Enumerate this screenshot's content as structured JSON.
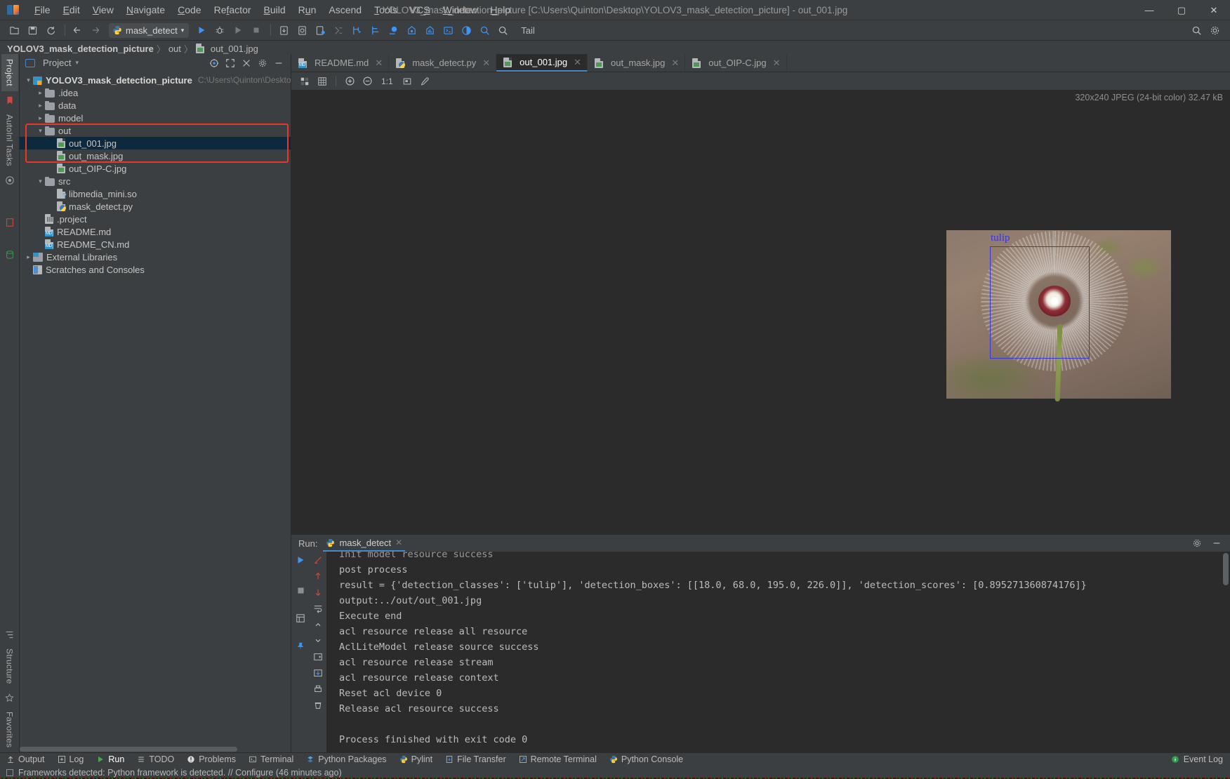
{
  "window": {
    "title": "YOLOV3_mask_detection_picture [C:\\Users\\Quinton\\Desktop\\YOLOV3_mask_detection_picture] - out_001.jpg",
    "minimize": "—",
    "maximize": "▢",
    "close": "✕"
  },
  "menu": [
    {
      "label": "File"
    },
    {
      "label": "Edit"
    },
    {
      "label": "View"
    },
    {
      "label": "Navigate"
    },
    {
      "label": "Code"
    },
    {
      "label": "Refactor"
    },
    {
      "label": "Build"
    },
    {
      "label": "Run"
    },
    {
      "label": "Ascend"
    },
    {
      "label": "Tools"
    },
    {
      "label": "VCS"
    },
    {
      "label": "Window"
    },
    {
      "label": "Help"
    }
  ],
  "toolbar": {
    "run_config": "mask_detect",
    "dropdown_arrow": "▾",
    "tail_label": "Tail"
  },
  "breadcrumb": {
    "project": "YOLOV3_mask_detection_picture",
    "folder": "out",
    "file": "out_001.jpg",
    "separator": "〉"
  },
  "left_stripe": {
    "project_tab": "Project",
    "ai_tab": "AutoInl Tasks",
    "structure_tab": "Structure",
    "favorites_tab": "Favorites"
  },
  "project_panel": {
    "title": "Project",
    "dropdown_arrow": "▾",
    "tree": [
      {
        "indent": 0,
        "arrow": "⌄",
        "icon": "module-icon",
        "label": "YOLOV3_mask_detection_picture",
        "bold": true,
        "path": "C:\\Users\\Quinton\\Desktop\\YOLO",
        "selected": false
      },
      {
        "indent": 1,
        "arrow": "›",
        "icon": "folder-icon",
        "label": ".idea",
        "bold": false,
        "path": "",
        "selected": false
      },
      {
        "indent": 1,
        "arrow": "›",
        "icon": "folder-icon",
        "label": "data",
        "bold": false,
        "path": "",
        "selected": false
      },
      {
        "indent": 1,
        "arrow": "›",
        "icon": "folder-icon",
        "label": "model",
        "bold": false,
        "path": "",
        "selected": false
      },
      {
        "indent": 1,
        "arrow": "⌄",
        "icon": "folder-icon",
        "label": "out",
        "bold": false,
        "path": "",
        "selected": false
      },
      {
        "indent": 2,
        "arrow": "",
        "icon": "image-file-icon",
        "label": "out_001.jpg",
        "bold": false,
        "path": "",
        "selected": true
      },
      {
        "indent": 2,
        "arrow": "",
        "icon": "image-file-icon",
        "label": "out_mask.jpg",
        "bold": false,
        "path": "",
        "selected": false
      },
      {
        "indent": 2,
        "arrow": "",
        "icon": "image-file-icon",
        "label": "out_OIP-C.jpg",
        "bold": false,
        "path": "",
        "selected": false
      },
      {
        "indent": 1,
        "arrow": "⌄",
        "icon": "folder-icon",
        "label": "src",
        "bold": false,
        "path": "",
        "selected": false
      },
      {
        "indent": 2,
        "arrow": "",
        "icon": "so-file-icon",
        "label": "libmedia_mini.so",
        "bold": false,
        "path": "",
        "selected": false
      },
      {
        "indent": 2,
        "arrow": "",
        "icon": "python-file-icon",
        "label": "mask_detect.py",
        "bold": false,
        "path": "",
        "selected": false
      },
      {
        "indent": 1,
        "arrow": "",
        "icon": "project-file-icon",
        "label": ".project",
        "bold": false,
        "path": "",
        "selected": false
      },
      {
        "indent": 1,
        "arrow": "",
        "icon": "markdown-file-icon",
        "label": "README.md",
        "bold": false,
        "path": "",
        "selected": false
      },
      {
        "indent": 1,
        "arrow": "",
        "icon": "markdown-file-icon",
        "label": "README_CN.md",
        "bold": false,
        "path": "",
        "selected": false
      },
      {
        "indent": 0,
        "arrow": "›",
        "icon": "library-icon",
        "label": "External Libraries",
        "bold": false,
        "path": "",
        "selected": false
      },
      {
        "indent": 0,
        "arrow": "",
        "icon": "scratches-icon",
        "label": "Scratches and Consoles",
        "bold": false,
        "path": "",
        "selected": false
      }
    ],
    "highlight_color": "#e8372c"
  },
  "editor": {
    "tabs": [
      {
        "label": "README.md",
        "icon": "markdown-file-icon",
        "active": false
      },
      {
        "label": "mask_detect.py",
        "icon": "python-file-icon",
        "active": false
      },
      {
        "label": "out_001.jpg",
        "icon": "image-file-icon",
        "active": true
      },
      {
        "label": "out_mask.jpg",
        "icon": "image-file-icon",
        "active": false
      },
      {
        "label": "out_OIP-C.jpg",
        "icon": "image-file-icon",
        "active": false
      }
    ],
    "close_glyph": "✕",
    "image_toolbar": {
      "ratio": "1:1",
      "icons": [
        "transparency-grid-icon",
        "grid-icon",
        "zoom-in-icon",
        "zoom-out-icon",
        "actual-size-icon",
        "fit-content-icon",
        "color-picker-icon"
      ]
    },
    "image_info": "320x240 JPEG (24-bit color) 32.47 kB",
    "detection_label": "tulip",
    "box_color": "#3838d8"
  },
  "run_panel": {
    "run_label": "Run:",
    "tab_label": "mask_detect",
    "close_glyph": "✕",
    "settings_icon": "gear-icon",
    "hide_icon": "minimize-icon",
    "console_lines": [
      "Init model resource success",
      "post process",
      "result =  {'detection_classes': ['tulip'], 'detection_boxes': [[18.0, 68.0, 195.0, 226.0]], 'detection_scores': [0.895271360874176]}",
      "output:../out/out_001.jpg",
      "Execute end",
      "acl resource release all resource",
      "AclLiteModel release source success",
      "acl resource release stream",
      "acl resource release context",
      "Reset acl device  0",
      "Release acl resource success",
      "",
      "Process finished with exit code 0"
    ],
    "gutter_icons": [
      "rerun-icon",
      "edit-config-icon",
      "stop-icon",
      "up-stack-icon",
      "down-stack-icon",
      "layout-icon",
      "soft-wrap-icon",
      "scroll-end-icon",
      "print-icon",
      "clear-all-icon",
      "pin-icon"
    ]
  },
  "tool_windows": [
    {
      "label": "Output",
      "icon": "output-icon",
      "active": false
    },
    {
      "label": "Log",
      "icon": "log-icon",
      "active": false
    },
    {
      "label": "Run",
      "icon": "run-icon",
      "active": true
    },
    {
      "label": "TODO",
      "icon": "todo-icon",
      "active": false
    },
    {
      "label": "Problems",
      "icon": "problems-icon",
      "active": false
    },
    {
      "label": "Terminal",
      "icon": "terminal-icon",
      "active": false
    },
    {
      "label": "Python Packages",
      "icon": "python-packages-icon",
      "active": false
    },
    {
      "label": "Pylint",
      "icon": "pylint-icon",
      "active": false
    },
    {
      "label": "File Transfer",
      "icon": "file-transfer-icon",
      "active": false
    },
    {
      "label": "Remote Terminal",
      "icon": "remote-terminal-icon",
      "active": false
    },
    {
      "label": "Python Console",
      "icon": "python-console-icon",
      "active": false
    }
  ],
  "event_log": {
    "label": "Event Log",
    "icon": "info-icon"
  },
  "statusbar": {
    "message": "Frameworks detected: Python framework is detected. // Configure (46 minutes ago)"
  }
}
